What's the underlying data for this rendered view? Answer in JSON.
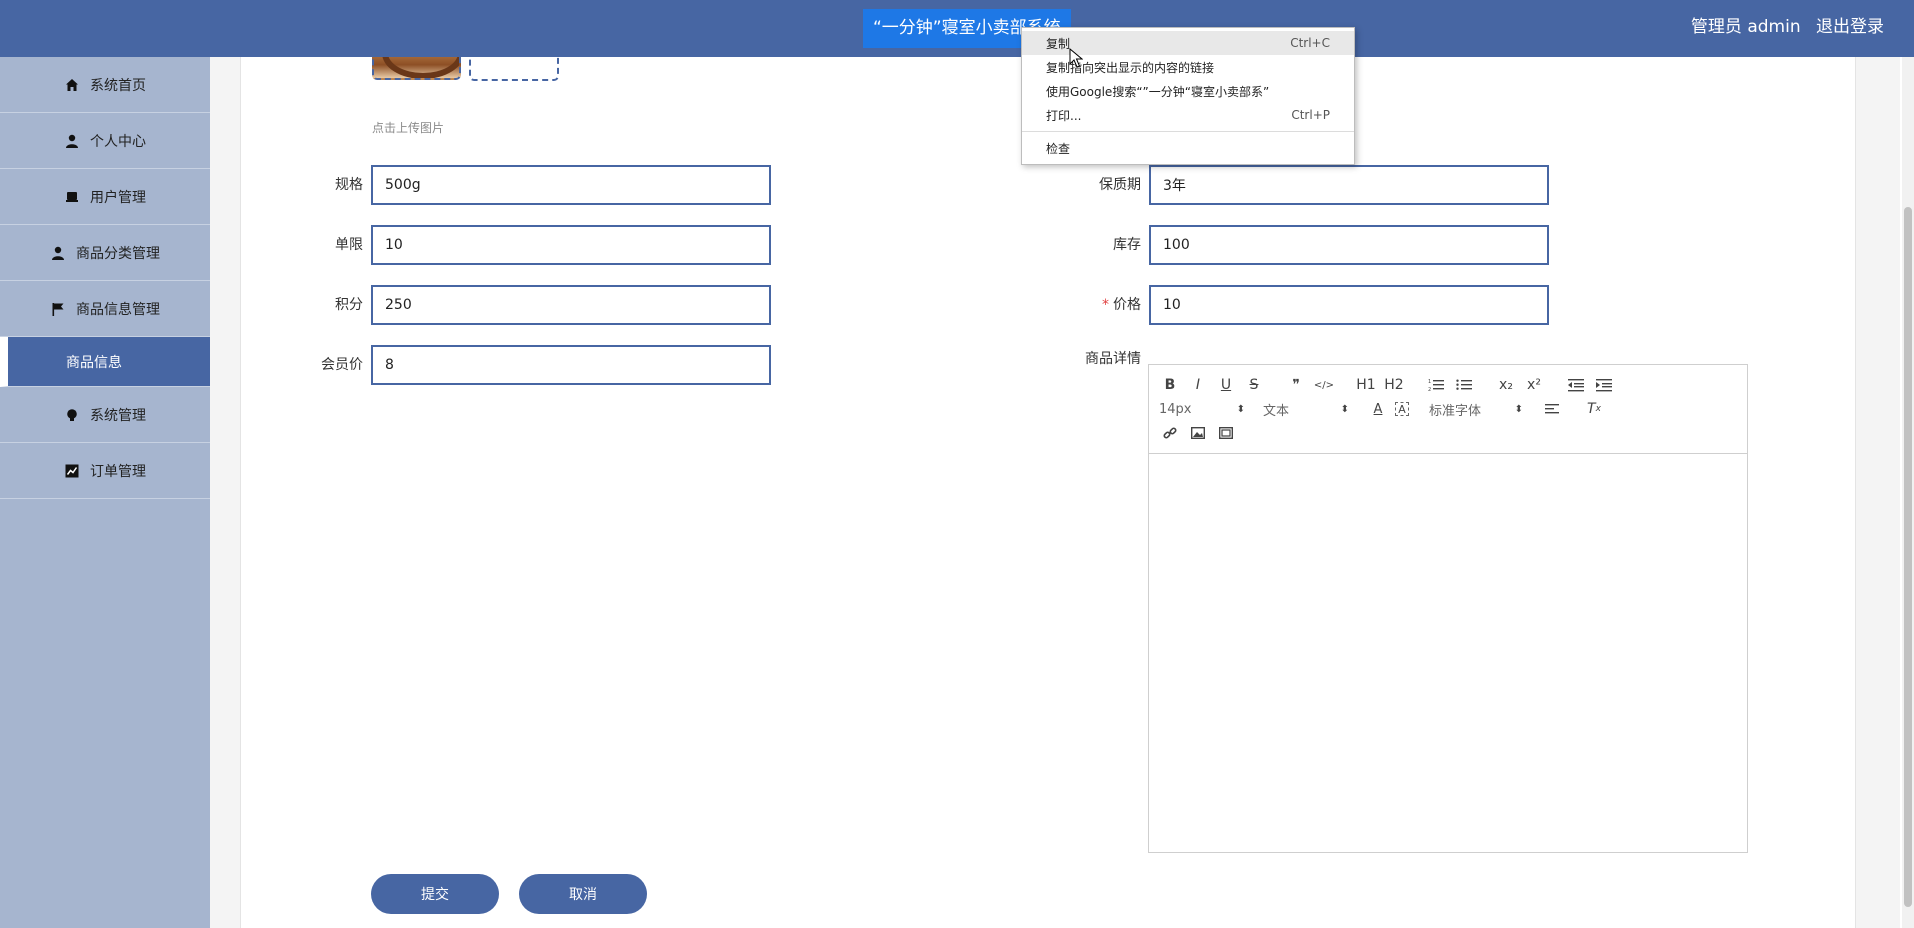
{
  "header": {
    "title": "“一分钟”寝室小卖部系统",
    "user": "管理员 admin",
    "logout": "退出登录"
  },
  "sidebar": {
    "items": [
      {
        "label": "系统首页",
        "icon": "home-icon"
      },
      {
        "label": "个人中心",
        "icon": "user-icon"
      },
      {
        "label": "用户管理",
        "icon": "box-icon"
      },
      {
        "label": "商品分类管理",
        "icon": "user-icon"
      },
      {
        "label": "商品信息管理",
        "icon": "flag-icon"
      },
      {
        "label": "商品信息",
        "icon": "",
        "active": true
      },
      {
        "label": "系统管理",
        "icon": "bulb-icon"
      },
      {
        "label": "订单管理",
        "icon": "chart-icon"
      }
    ]
  },
  "form": {
    "upload_hint": "点击上传图片",
    "spec": {
      "label": "规格",
      "value": "500g"
    },
    "shelf_life": {
      "label": "保质期",
      "value": "3年"
    },
    "limit": {
      "label": "单限",
      "value": "10"
    },
    "stock": {
      "label": "库存",
      "value": "100"
    },
    "points": {
      "label": "积分",
      "value": "250"
    },
    "price": {
      "label": "价格",
      "value": "10",
      "required": "*"
    },
    "member_price": {
      "label": "会员价",
      "value": "8"
    },
    "details": {
      "label": "商品详情"
    }
  },
  "editor": {
    "font_size": "14px",
    "paragraph": "文本",
    "font_family": "标准字体",
    "buttons": [
      "B",
      "I",
      "U",
      "S",
      "❞",
      "</>",
      "H1",
      "H2",
      "ol",
      "ul",
      "x₂",
      "x²",
      "outdent",
      "indent"
    ]
  },
  "buttons": {
    "submit": "提交",
    "cancel": "取消"
  },
  "context_menu": {
    "items": [
      {
        "label": "复制",
        "shortcut": "Ctrl+C"
      },
      {
        "label": "复制指向突出显示的内容的链接",
        "shortcut": ""
      },
      {
        "label": "使用Google搜索“”一分钟“寝室小卖部系”",
        "shortcut": ""
      },
      {
        "label": "打印...",
        "shortcut": "Ctrl+P"
      },
      {
        "label": "检查",
        "shortcut": ""
      }
    ]
  },
  "colors": {
    "primary": "#4766a3",
    "highlight": "#1e78e6",
    "sidebar": "#a6b5cf",
    "required": "#e04040"
  }
}
